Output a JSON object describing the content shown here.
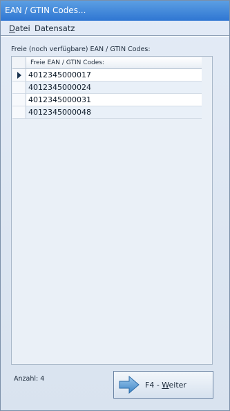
{
  "window": {
    "title": "EAN / GTIN Codes..."
  },
  "menu": {
    "file": "Datei",
    "record": "Datensatz"
  },
  "caption": "Freie (noch verfügbare) EAN / GTIN Codes:",
  "grid": {
    "header": "Freie EAN / GTIN Codes:",
    "rows": [
      "4012345000017",
      "4012345000024",
      "4012345000031",
      "4012345000048"
    ]
  },
  "footer": {
    "count_label": "Anzahl: 4",
    "next_button_prefix": "F4 - ",
    "next_button_accel": "W",
    "next_button_rest": "eiter",
    "next_icon": "arrow-right-icon"
  }
}
